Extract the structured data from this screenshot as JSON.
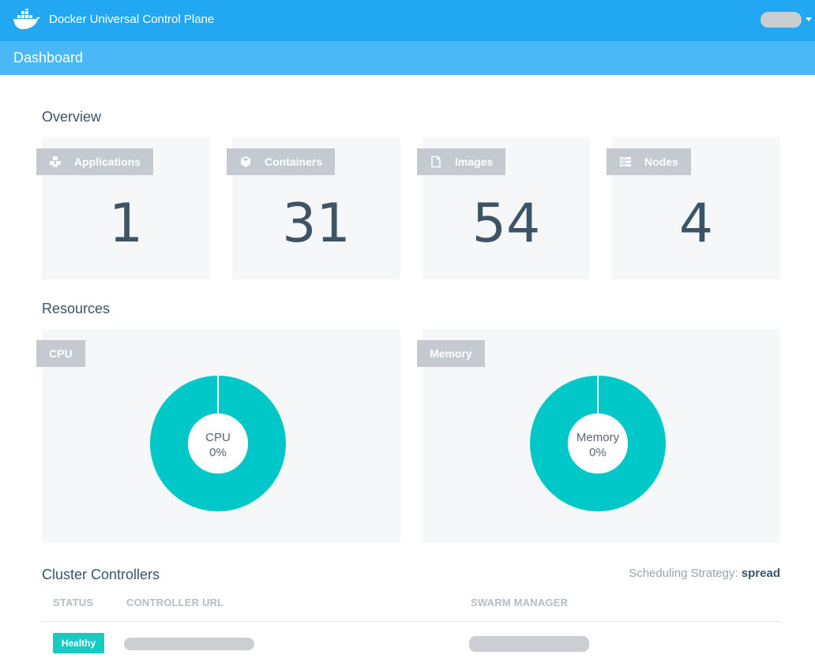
{
  "header": {
    "app_title": "Docker Universal Control Plane",
    "logo_icon": "docker-whale-icon",
    "user_menu_icon": "chevron-down-icon"
  },
  "subheader": {
    "page_title": "Dashboard"
  },
  "overview": {
    "title": "Overview",
    "cards": [
      {
        "label": "Applications",
        "value": "1",
        "icon": "applications-icon"
      },
      {
        "label": "Containers",
        "value": "31",
        "icon": "cube-icon"
      },
      {
        "label": "Images",
        "value": "54",
        "icon": "file-icon"
      },
      {
        "label": "Nodes",
        "value": "4",
        "icon": "server-icon"
      }
    ]
  },
  "resources": {
    "title": "Resources",
    "charts": [
      {
        "tag": "CPU",
        "label": "CPU",
        "value_text": "0%",
        "value": 0
      },
      {
        "tag": "Memory",
        "label": "Memory",
        "value_text": "0%",
        "value": 0
      }
    ]
  },
  "cluster": {
    "title": "Cluster Controllers",
    "strategy_label": "Scheduling Strategy:",
    "strategy_value": "spread",
    "columns": [
      "STATUS",
      "CONTROLLER URL",
      "SWARM MANAGER"
    ],
    "rows": [
      {
        "status": "Healthy"
      }
    ]
  },
  "colors": {
    "topbar": "#22a8f2",
    "subbar": "#4ab8f7",
    "accent_teal": "#00c8c8",
    "card_bg": "#f5f7f9",
    "tag_bg": "#c4cad0",
    "text_dark": "#3d5466"
  }
}
